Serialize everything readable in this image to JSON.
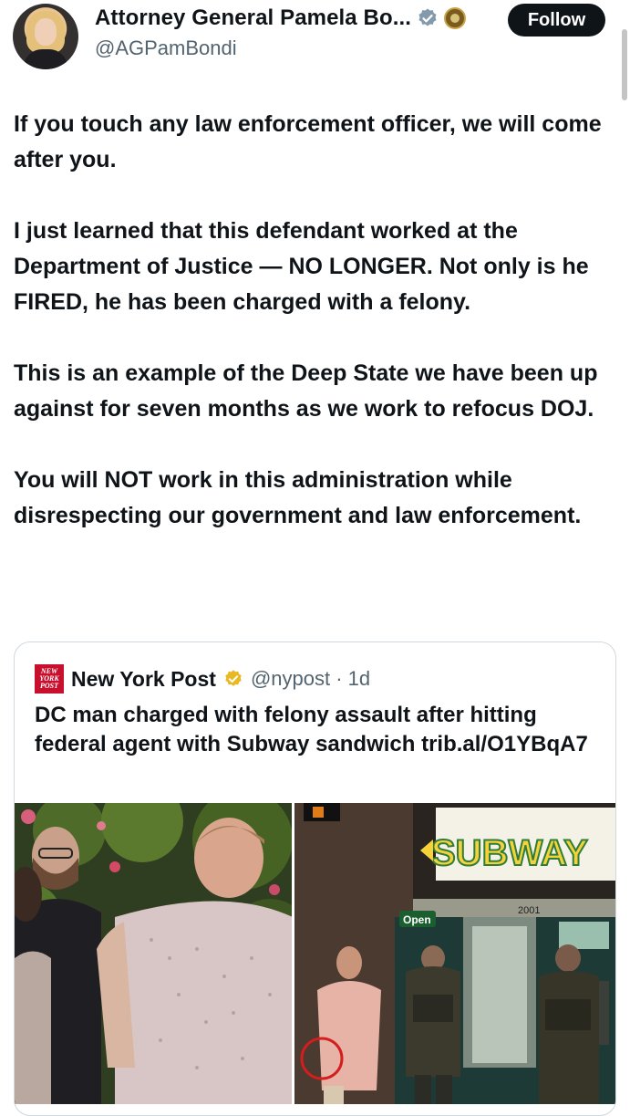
{
  "author": {
    "display_name": "Attorney General Pamela Bo...",
    "handle": "@AGPamBondi",
    "verified_icon": "verified-badge-icon",
    "affiliation_icon": "doj-seal-icon"
  },
  "follow_label": "Follow",
  "tweet": {
    "paragraphs": [
      "If you touch any law enforcement officer, we will come after you.",
      "I just learned that this defendant worked at the Department of Justice — NO LONGER. Not only is he FIRED, he has been charged with a felony.",
      "This is an example of the Deep State we have been up against for seven months as we work to refocus DOJ.",
      "You will NOT work in this administration while disrespecting our government and law enforcement."
    ]
  },
  "quoted": {
    "logo_text": [
      "NEW",
      "YORK",
      "POST"
    ],
    "name": "New York Post",
    "handle_time": "@nypost · 1d",
    "text": "DC man charged with felony assault after hitting federal agent with Subway sandwich trib.al/O1YBqA7",
    "photo_signs": {
      "store": "SUBWAY",
      "open": "Open",
      "address": "2001"
    }
  },
  "colors": {
    "text": "#0f1419",
    "secondary": "#536471",
    "border": "#cfd9de",
    "nypost_red": "#c8102e",
    "verified_blue": "#829aab",
    "gold": "#e8b923"
  }
}
